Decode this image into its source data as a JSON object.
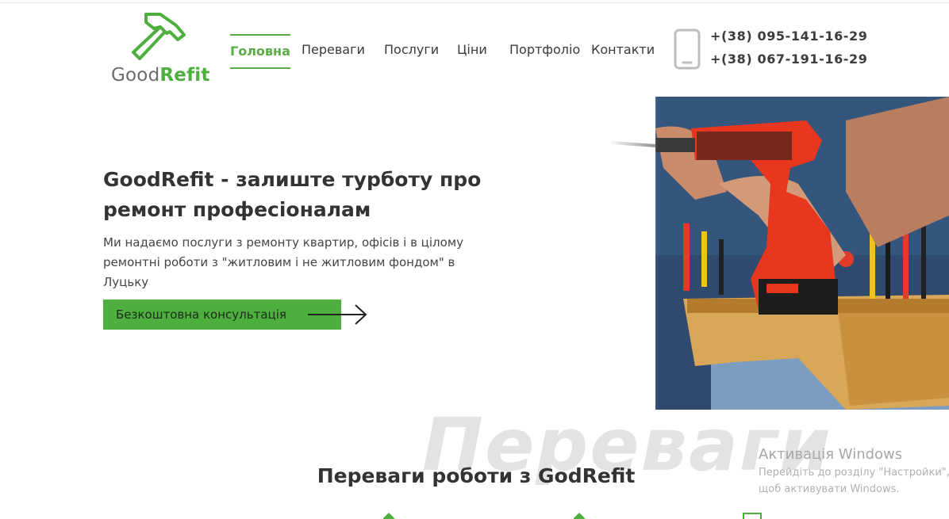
{
  "logo": {
    "part1": "Good",
    "part2": "Refit",
    "icon": "hammer-icon"
  },
  "nav": {
    "items": [
      {
        "label": "Головна",
        "active": true
      },
      {
        "label": "Переваги",
        "active": false
      },
      {
        "label": "Послуги",
        "active": false
      },
      {
        "label": "Ціни",
        "active": false
      },
      {
        "label": "Портфоліо",
        "active": false
      },
      {
        "label": "Контакти",
        "active": false
      }
    ]
  },
  "contacts": {
    "icon": "smartphone-icon",
    "phone1": "+(38) 095-141-16-29",
    "phone2": "+(38) 067-191-16-29"
  },
  "hero": {
    "title": "GoodRefit - залиште турботу про ремонт професіоналам",
    "description": "Ми надаємо послуги з ремонту квартир, офісів і в цілому ремонтні роботи з \"житловим і не житловим фондом\" в Луцьку",
    "cta_label": "Безкоштовна консультація",
    "arrow_icon": "arrow-right-icon",
    "image": "worker-with-drill-photo"
  },
  "advantages": {
    "watermark": "Переваги",
    "title": "Переваги роботи з GodRefit"
  },
  "windows_activation": {
    "title": "Активація Windows",
    "text": "Перейдіть до розділу \"Настройки\", щоб активувати Windows."
  },
  "colors": {
    "accent": "#4caf3e",
    "text": "#333333",
    "watermark": "#e3e3e3"
  }
}
